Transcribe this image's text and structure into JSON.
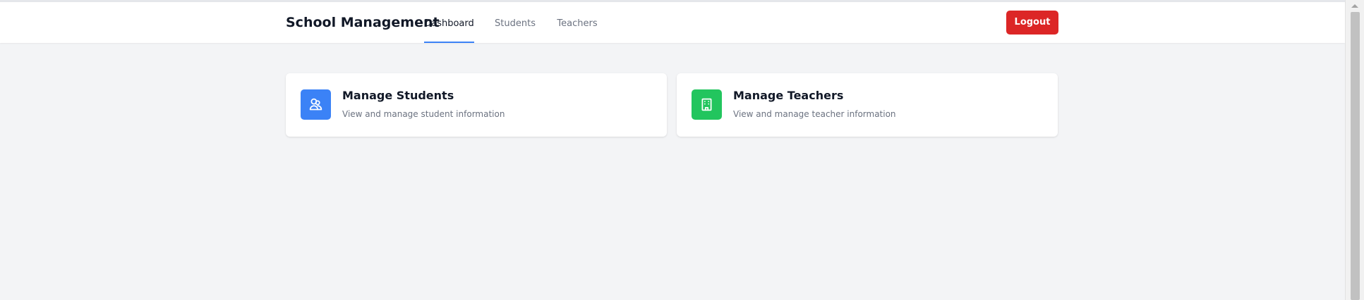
{
  "app": {
    "title": "School Management"
  },
  "nav": {
    "items": [
      {
        "label": "Dashboard",
        "active": true
      },
      {
        "label": "Students",
        "active": false
      },
      {
        "label": "Teachers",
        "active": false
      }
    ],
    "logout_label": "Logout"
  },
  "cards": [
    {
      "title": "Manage Students",
      "description": "View and manage student information",
      "icon": "users-icon",
      "color": "#3b82f6"
    },
    {
      "title": "Manage Teachers",
      "description": "View and manage teacher information",
      "icon": "building-icon",
      "color": "#22c55e"
    }
  ],
  "colors": {
    "accent": "#3b82f6",
    "danger": "#dc2626",
    "success": "#22c55e",
    "background": "#f3f4f6"
  }
}
